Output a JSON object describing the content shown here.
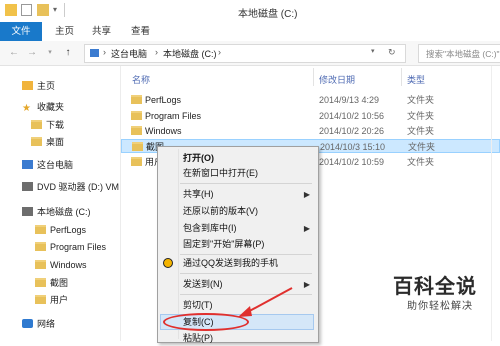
{
  "window": {
    "title": "本地磁盘 (C:)"
  },
  "ribbon": {
    "tabs": [
      "文件",
      "主页",
      "共享",
      "查看"
    ]
  },
  "address": {
    "path": [
      "这台电脑",
      "本地磁盘 (C:)"
    ],
    "search_placeholder": "搜索\"本地磁盘 (C:)\""
  },
  "sidebar": {
    "items": [
      {
        "label": "主页",
        "icon": "home-icon"
      },
      {
        "label": "收藏夹",
        "icon": "star-icon"
      },
      {
        "label": "下载",
        "icon": "folder-icon"
      },
      {
        "label": "桌面",
        "icon": "folder-icon"
      },
      {
        "label": "这台电脑",
        "icon": "computer-icon"
      },
      {
        "label": "DVD 驱动器 (D:) VM",
        "icon": "dvd-icon"
      },
      {
        "label": "本地磁盘 (C:)",
        "icon": "drive-icon"
      },
      {
        "label": "PerfLogs",
        "icon": "folder-icon"
      },
      {
        "label": "Program Files",
        "icon": "folder-icon"
      },
      {
        "label": "Windows",
        "icon": "folder-icon"
      },
      {
        "label": "截图",
        "icon": "folder-icon"
      },
      {
        "label": "用户",
        "icon": "folder-icon"
      },
      {
        "label": "网络",
        "icon": "network-icon"
      }
    ]
  },
  "filelist": {
    "columns": [
      "名称",
      "修改日期",
      "类型"
    ],
    "rows": [
      {
        "name": "PerfLogs",
        "date": "2014/9/13 4:29",
        "type": "文件夹"
      },
      {
        "name": "Program Files",
        "date": "2014/10/2 10:56",
        "type": "文件夹"
      },
      {
        "name": "Windows",
        "date": "2014/10/2 20:26",
        "type": "文件夹"
      },
      {
        "name": "截图",
        "date": "2014/10/3 15:10",
        "type": "文件夹"
      },
      {
        "name": "用户",
        "date": "2014/10/2 10:59",
        "type": "文件夹"
      }
    ]
  },
  "context_menu": {
    "items": [
      "打开(O)",
      "在新窗口中打开(E)",
      "共享(H)",
      "还原以前的版本(V)",
      "包含到库中(I)",
      "固定到\"开始\"屏幕(P)",
      "通过QQ发送到我的手机",
      "发送到(N)",
      "剪切(T)",
      "复制(C)",
      "粘贴(P)"
    ]
  },
  "watermark": {
    "title": "百科全说",
    "subtitle": "助你轻松解决"
  },
  "colors": {
    "accent": "#1979ca",
    "selection": "#cce8ff",
    "annotation": "#e0302e"
  }
}
